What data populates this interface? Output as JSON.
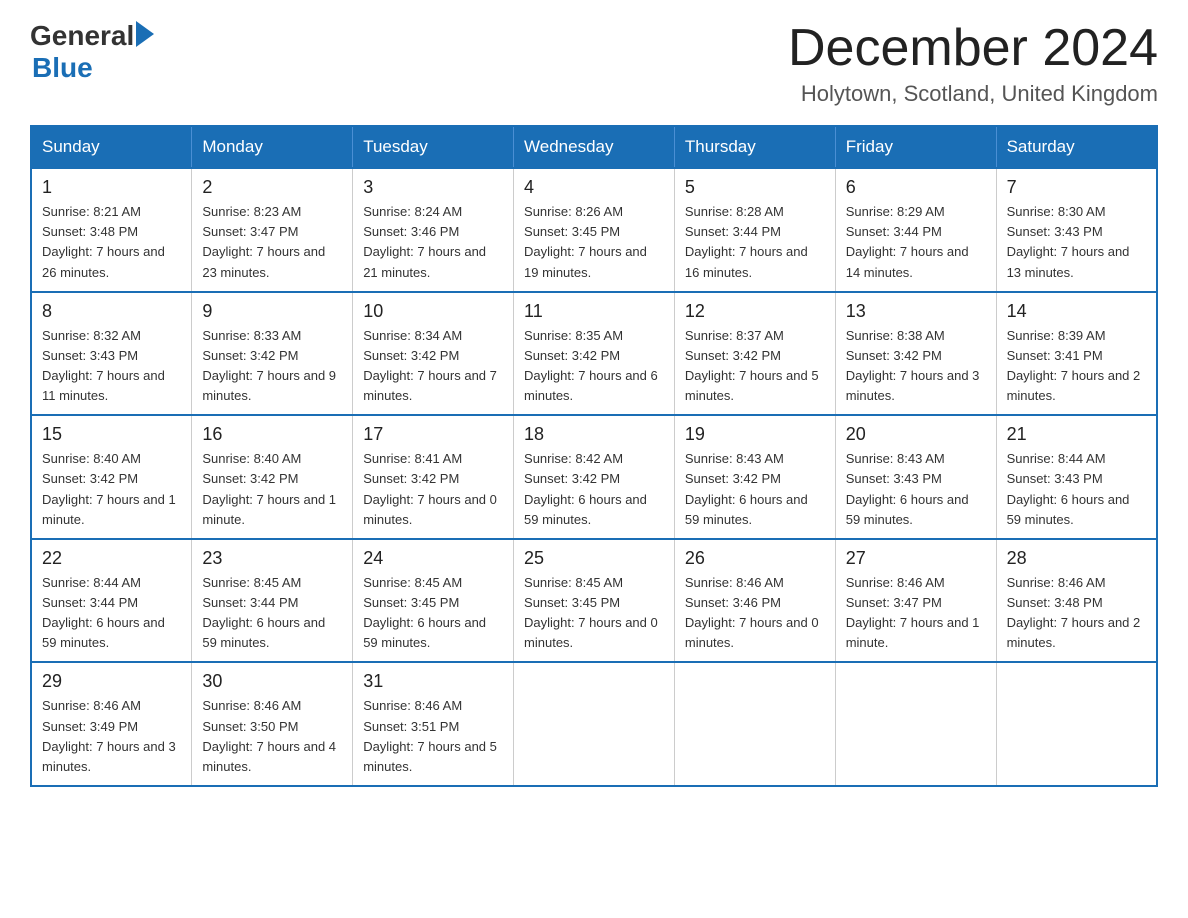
{
  "header": {
    "logo_general": "General",
    "logo_blue": "Blue",
    "main_title": "December 2024",
    "subtitle": "Holytown, Scotland, United Kingdom"
  },
  "calendar": {
    "days_of_week": [
      "Sunday",
      "Monday",
      "Tuesday",
      "Wednesday",
      "Thursday",
      "Friday",
      "Saturday"
    ],
    "weeks": [
      [
        {
          "day": "1",
          "sunrise": "Sunrise: 8:21 AM",
          "sunset": "Sunset: 3:48 PM",
          "daylight": "Daylight: 7 hours and 26 minutes."
        },
        {
          "day": "2",
          "sunrise": "Sunrise: 8:23 AM",
          "sunset": "Sunset: 3:47 PM",
          "daylight": "Daylight: 7 hours and 23 minutes."
        },
        {
          "day": "3",
          "sunrise": "Sunrise: 8:24 AM",
          "sunset": "Sunset: 3:46 PM",
          "daylight": "Daylight: 7 hours and 21 minutes."
        },
        {
          "day": "4",
          "sunrise": "Sunrise: 8:26 AM",
          "sunset": "Sunset: 3:45 PM",
          "daylight": "Daylight: 7 hours and 19 minutes."
        },
        {
          "day": "5",
          "sunrise": "Sunrise: 8:28 AM",
          "sunset": "Sunset: 3:44 PM",
          "daylight": "Daylight: 7 hours and 16 minutes."
        },
        {
          "day": "6",
          "sunrise": "Sunrise: 8:29 AM",
          "sunset": "Sunset: 3:44 PM",
          "daylight": "Daylight: 7 hours and 14 minutes."
        },
        {
          "day": "7",
          "sunrise": "Sunrise: 8:30 AM",
          "sunset": "Sunset: 3:43 PM",
          "daylight": "Daylight: 7 hours and 13 minutes."
        }
      ],
      [
        {
          "day": "8",
          "sunrise": "Sunrise: 8:32 AM",
          "sunset": "Sunset: 3:43 PM",
          "daylight": "Daylight: 7 hours and 11 minutes."
        },
        {
          "day": "9",
          "sunrise": "Sunrise: 8:33 AM",
          "sunset": "Sunset: 3:42 PM",
          "daylight": "Daylight: 7 hours and 9 minutes."
        },
        {
          "day": "10",
          "sunrise": "Sunrise: 8:34 AM",
          "sunset": "Sunset: 3:42 PM",
          "daylight": "Daylight: 7 hours and 7 minutes."
        },
        {
          "day": "11",
          "sunrise": "Sunrise: 8:35 AM",
          "sunset": "Sunset: 3:42 PM",
          "daylight": "Daylight: 7 hours and 6 minutes."
        },
        {
          "day": "12",
          "sunrise": "Sunrise: 8:37 AM",
          "sunset": "Sunset: 3:42 PM",
          "daylight": "Daylight: 7 hours and 5 minutes."
        },
        {
          "day": "13",
          "sunrise": "Sunrise: 8:38 AM",
          "sunset": "Sunset: 3:42 PM",
          "daylight": "Daylight: 7 hours and 3 minutes."
        },
        {
          "day": "14",
          "sunrise": "Sunrise: 8:39 AM",
          "sunset": "Sunset: 3:41 PM",
          "daylight": "Daylight: 7 hours and 2 minutes."
        }
      ],
      [
        {
          "day": "15",
          "sunrise": "Sunrise: 8:40 AM",
          "sunset": "Sunset: 3:42 PM",
          "daylight": "Daylight: 7 hours and 1 minute."
        },
        {
          "day": "16",
          "sunrise": "Sunrise: 8:40 AM",
          "sunset": "Sunset: 3:42 PM",
          "daylight": "Daylight: 7 hours and 1 minute."
        },
        {
          "day": "17",
          "sunrise": "Sunrise: 8:41 AM",
          "sunset": "Sunset: 3:42 PM",
          "daylight": "Daylight: 7 hours and 0 minutes."
        },
        {
          "day": "18",
          "sunrise": "Sunrise: 8:42 AM",
          "sunset": "Sunset: 3:42 PM",
          "daylight": "Daylight: 6 hours and 59 minutes."
        },
        {
          "day": "19",
          "sunrise": "Sunrise: 8:43 AM",
          "sunset": "Sunset: 3:42 PM",
          "daylight": "Daylight: 6 hours and 59 minutes."
        },
        {
          "day": "20",
          "sunrise": "Sunrise: 8:43 AM",
          "sunset": "Sunset: 3:43 PM",
          "daylight": "Daylight: 6 hours and 59 minutes."
        },
        {
          "day": "21",
          "sunrise": "Sunrise: 8:44 AM",
          "sunset": "Sunset: 3:43 PM",
          "daylight": "Daylight: 6 hours and 59 minutes."
        }
      ],
      [
        {
          "day": "22",
          "sunrise": "Sunrise: 8:44 AM",
          "sunset": "Sunset: 3:44 PM",
          "daylight": "Daylight: 6 hours and 59 minutes."
        },
        {
          "day": "23",
          "sunrise": "Sunrise: 8:45 AM",
          "sunset": "Sunset: 3:44 PM",
          "daylight": "Daylight: 6 hours and 59 minutes."
        },
        {
          "day": "24",
          "sunrise": "Sunrise: 8:45 AM",
          "sunset": "Sunset: 3:45 PM",
          "daylight": "Daylight: 6 hours and 59 minutes."
        },
        {
          "day": "25",
          "sunrise": "Sunrise: 8:45 AM",
          "sunset": "Sunset: 3:45 PM",
          "daylight": "Daylight: 7 hours and 0 minutes."
        },
        {
          "day": "26",
          "sunrise": "Sunrise: 8:46 AM",
          "sunset": "Sunset: 3:46 PM",
          "daylight": "Daylight: 7 hours and 0 minutes."
        },
        {
          "day": "27",
          "sunrise": "Sunrise: 8:46 AM",
          "sunset": "Sunset: 3:47 PM",
          "daylight": "Daylight: 7 hours and 1 minute."
        },
        {
          "day": "28",
          "sunrise": "Sunrise: 8:46 AM",
          "sunset": "Sunset: 3:48 PM",
          "daylight": "Daylight: 7 hours and 2 minutes."
        }
      ],
      [
        {
          "day": "29",
          "sunrise": "Sunrise: 8:46 AM",
          "sunset": "Sunset: 3:49 PM",
          "daylight": "Daylight: 7 hours and 3 minutes."
        },
        {
          "day": "30",
          "sunrise": "Sunrise: 8:46 AM",
          "sunset": "Sunset: 3:50 PM",
          "daylight": "Daylight: 7 hours and 4 minutes."
        },
        {
          "day": "31",
          "sunrise": "Sunrise: 8:46 AM",
          "sunset": "Sunset: 3:51 PM",
          "daylight": "Daylight: 7 hours and 5 minutes."
        },
        null,
        null,
        null,
        null
      ]
    ]
  }
}
